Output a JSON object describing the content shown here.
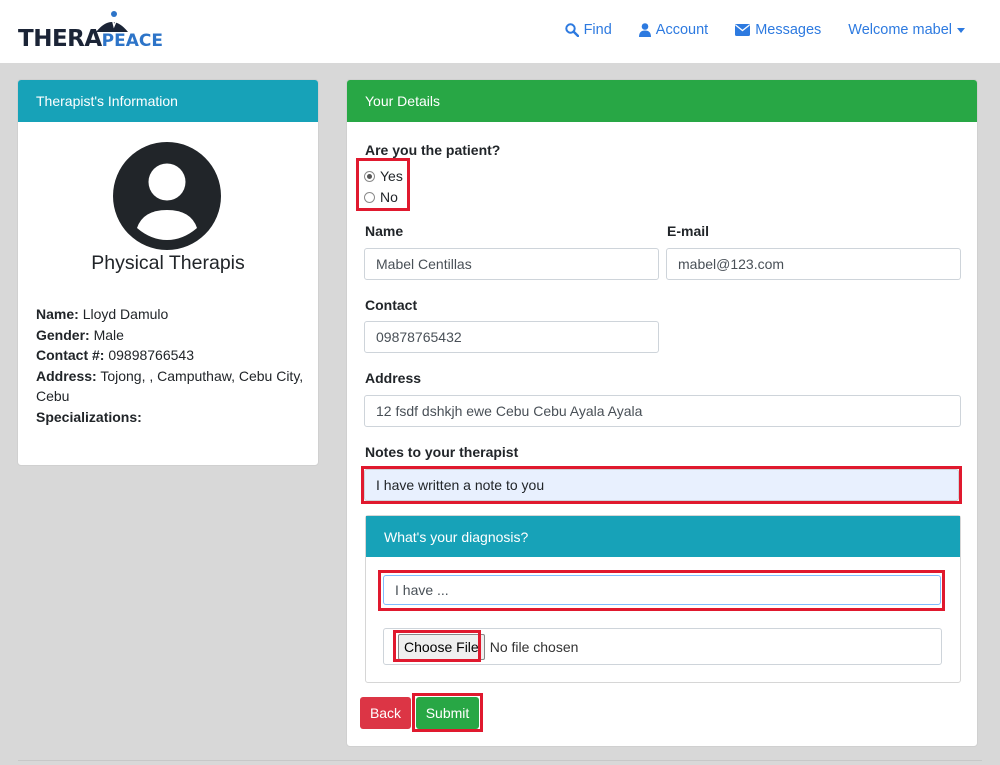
{
  "brand": {
    "part1": "THERA",
    "part2": "PEACE"
  },
  "nav": {
    "find": "Find",
    "account": "Account",
    "messages": "Messages",
    "welcome": "Welcome mabel"
  },
  "therapist_card": {
    "header": "Therapist's Information",
    "title": "Physical Therapis",
    "fields": [
      {
        "label": "Name:",
        "value": "Lloyd Damulo"
      },
      {
        "label": "Gender:",
        "value": "Male"
      },
      {
        "label": "Contact #:",
        "value": "09898766543"
      },
      {
        "label": "Address:",
        "value": "Tojong, , Camputhaw, Cebu City, Cebu"
      },
      {
        "label": "Specializations:",
        "value": ""
      }
    ]
  },
  "details_card": {
    "header": "Your Details",
    "patient_question": "Are you the patient?",
    "options": [
      {
        "label": "Yes",
        "checked": true
      },
      {
        "label": "No",
        "checked": false
      }
    ],
    "name_label": "Name",
    "name_value": "Mabel Centillas",
    "email_label": "E-mail",
    "email_value": "mabel@123.com",
    "contact_label": "Contact",
    "contact_value": "09878765432",
    "address_label": "Address",
    "address_value": "12 fsdf dshkjh ewe Cebu Cebu Ayala Ayala",
    "notes_label": "Notes to your therapist",
    "notes_value": "I have written a note to you",
    "diagnosis_header": "What's your diagnosis?",
    "diagnosis_value": "I have ...",
    "file_button": "Choose File",
    "file_status": "No file chosen",
    "back_button": "Back",
    "submit_button": "Submit"
  },
  "colors": {
    "info": "#17a2b8",
    "success": "#28a745",
    "danger": "#dc3545",
    "link": "#2d7ae0",
    "highlight": "#e0192e"
  }
}
